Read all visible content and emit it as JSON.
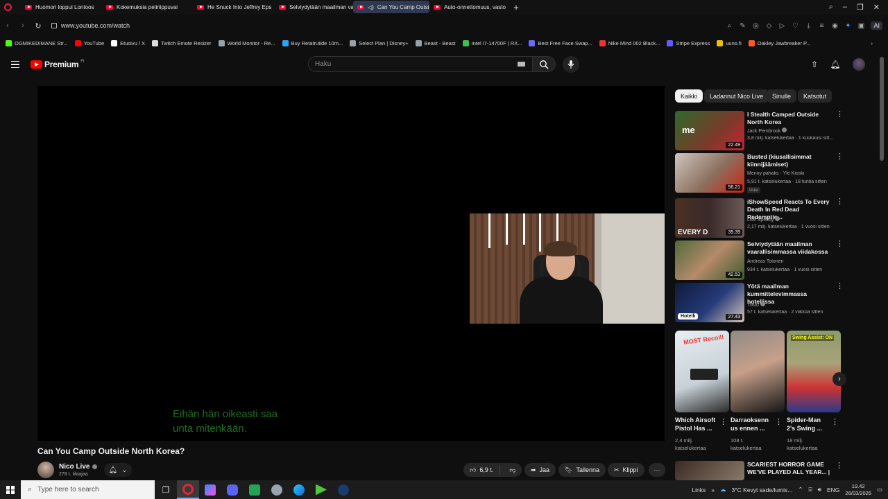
{
  "browser": {
    "tabs": [
      {
        "label": "Huomori loppui Lontoos",
        "active": false
      },
      {
        "label": "Kokemuksia peliriippuvai",
        "active": false
      },
      {
        "label": "He Snuck Into Jeffrey Eps",
        "active": false
      },
      {
        "label": "Selviydytään maailman va",
        "active": false
      },
      {
        "label": "Can You Camp Outsid",
        "active": true
      },
      {
        "label": "Auto-onnettomuus, vasto",
        "active": false
      }
    ],
    "url": "www.youtube.com/watch",
    "ai_label": "AI",
    "bookmarks": [
      {
        "label": "OGMIKEDIMANE Str...",
        "color": "#53fc18"
      },
      {
        "label": "YouTube",
        "color": "#ff0000"
      },
      {
        "label": "Etusivu / X",
        "color": "#ffffff"
      },
      {
        "label": "Twitch Emote Resizer",
        "color": "#dddddd"
      },
      {
        "label": "World Monitor - Re...",
        "color": "#9aa0a6"
      },
      {
        "label": "Buy Retatrutide 10m...",
        "color": "#2aa4f4"
      },
      {
        "label": "Select Plan | Disney+",
        "color": "#9aa0a6"
      },
      {
        "label": "Beast - Beast",
        "color": "#9aa0a6"
      },
      {
        "label": "Intel i7-14700F | RX...",
        "color": "#3fbf4f"
      },
      {
        "label": "Best Free Face Swap...",
        "color": "#6b6bff"
      },
      {
        "label": "Nike Mind 002 Black...",
        "color": "#e33"
      },
      {
        "label": "Stripe Express",
        "color": "#635bff"
      },
      {
        "label": "uuno.fi",
        "color": "#e8c200"
      },
      {
        "label": "Oakley Jawbreaker P...",
        "color": "#ff5a1f"
      }
    ]
  },
  "youtube": {
    "logo_text": "Premium",
    "logo_sup": "FI",
    "search_placeholder": "Haku"
  },
  "video": {
    "subtitle_line1": "Eihän hän oikeasti saa",
    "subtitle_line2": "unta mitenkään.",
    "title": "Can You Camp Outside North Korea?",
    "channel": "Nico Live",
    "subscribers": "278 t. tilaajaa",
    "likes": "6,9 t.",
    "share_label": "Jaa",
    "save_label": "Tallenna",
    "clip_label": "Klippi",
    "more": "···"
  },
  "chips": [
    "Kaikki",
    "Ladannut Nico Live",
    "Sinulle",
    "Katsotut"
  ],
  "recommendations": [
    {
      "title": "I Stealth Camped Outside North Korea",
      "channel": "Jack Pembrook",
      "meta": "3,8 milj. katselukertaa · 1 kuukausi sitt...",
      "duration": "22.49",
      "verified": true
    },
    {
      "title": "Busted (kiusallisimmat kiinnijäämiset)",
      "channel": "Menny pahaks · Yle Kioski",
      "meta": "5,91 t. katselukertaa · 18 tuntia sitten",
      "duration": "56.21",
      "badge": "Uusi",
      "verified": false
    },
    {
      "title": "iShowSpeed Reacts To Every Death In Red Dead Redemptio...",
      "channel": "Live Speedy",
      "meta": "2,17 milj. katselukertaa · 1 vuosi sitten",
      "duration": "39.39",
      "verified": true
    },
    {
      "title": "Selviydytään maailman vaarallisimmassa viidakossa",
      "channel": "Andreas Tolonen",
      "meta": "934 t. katselukertaa · 1 vuosi sitten",
      "duration": "42.53",
      "verified": false
    },
    {
      "title": "Yötä maailman kummittelevimmassa hotellissa",
      "channel": "Tixuu",
      "meta": "57 t. katselukertaa · 2 viikkoa sitten",
      "duration": "27.43",
      "tag": "Hotelli",
      "verified": true
    }
  ],
  "shorts": [
    {
      "title1": "Which Airsoft",
      "title2": "Pistol Has ...",
      "meta1": "2,4 milj.",
      "meta2": "katselukertaa",
      "overlay": "MOST Recoil!"
    },
    {
      "title1": "Darraoksenn",
      "title2": "us ennen ...",
      "meta1": "108 t.",
      "meta2": "katselukertaa",
      "overlay": ""
    },
    {
      "title1": "Spider-Man",
      "title2": "2's Swing ...",
      "meta1": "18 milj.",
      "meta2": "katselukertaa",
      "overlay": "Swing Assist: ON"
    }
  ],
  "next_rec": {
    "title": "SCARIEST HORROR GAME WE'VE PLAYED ALL YEAR... | ..."
  },
  "taskbar": {
    "search_placeholder": "Type here to search",
    "links": "Links",
    "weather": "3°C  Kevyt sade/lumis...",
    "lang": "ENG",
    "time": "19.42",
    "date": "26/03/2026"
  }
}
